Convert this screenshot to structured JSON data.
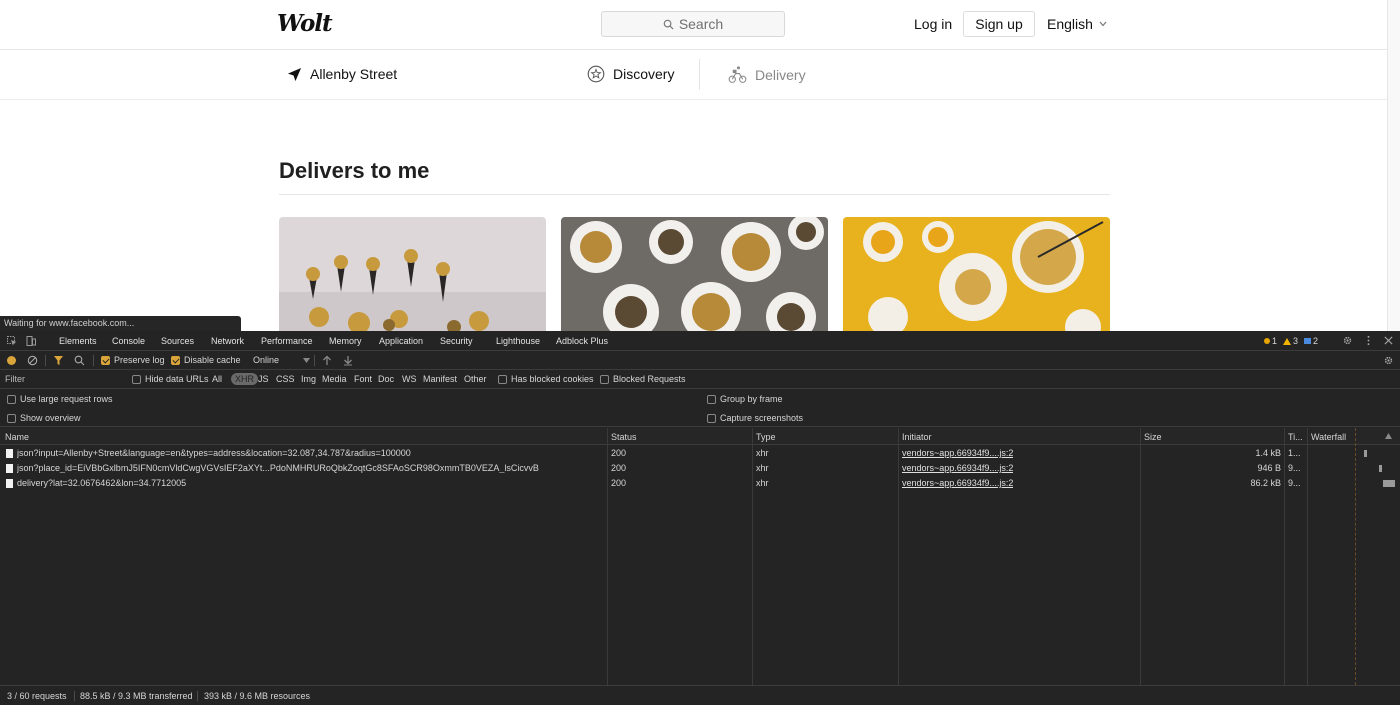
{
  "site": {
    "logo": "Wolt",
    "search_placeholder": "Search",
    "login": "Log in",
    "signup": "Sign up",
    "language": "English",
    "address": "Allenby Street",
    "discovery": "Discovery",
    "delivery": "Delivery",
    "section_title": "Delivers to me",
    "status_tip": "Waiting for www.facebook.com..."
  },
  "devtools": {
    "tabs": [
      "Elements",
      "Console",
      "Sources",
      "Network",
      "Performance",
      "Memory",
      "Application",
      "Security",
      "Lighthouse",
      "Adblock Plus"
    ],
    "counters": {
      "errors": "1",
      "warnings": "3",
      "info": "2"
    },
    "toolbar": {
      "preserve_log": "Preserve log",
      "disable_cache": "Disable cache",
      "throttle": "Online"
    },
    "filter": {
      "label": "Filter",
      "hide_data_urls": "Hide data URLs",
      "types": [
        "All",
        "XHR",
        "JS",
        "CSS",
        "Img",
        "Media",
        "Font",
        "Doc",
        "WS",
        "Manifest",
        "Other"
      ],
      "has_blocked_cookies": "Has blocked cookies",
      "blocked_requests": "Blocked Requests"
    },
    "options": {
      "large_rows": "Use large request rows",
      "show_overview": "Show overview",
      "group_by_frame": "Group by frame",
      "capture_screenshots": "Capture screenshots"
    },
    "columns": {
      "name": "Name",
      "status": "Status",
      "type": "Type",
      "initiator": "Initiator",
      "size": "Size",
      "time": "Ti...",
      "waterfall": "Waterfall"
    },
    "requests": [
      {
        "name": "json?input=Allenby+Street&language=en&types=address&location=32.087,34.787&radius=100000",
        "status": "200",
        "type": "xhr",
        "initiator": "vendors~app.66934f9....js:2",
        "size": "1.4 kB",
        "time": "1...",
        "waterfall_start": 0.62,
        "waterfall_width": 0.03
      },
      {
        "name": "json?place_id=EiVBbGxlbmJ5IFN0cmVldCwgVGVsIEF2aXYt...PdoNMHRURoQbkZoqtGc8SFAoSCR98OxmmTB0VEZA_lsCicvvB",
        "status": "200",
        "type": "xhr",
        "initiator": "vendors~app.66934f9....js:2",
        "size": "946 B",
        "time": "9...",
        "waterfall_start": 0.8,
        "waterfall_width": 0.03
      },
      {
        "name": "delivery?lat=32.0676462&lon=34.7712005",
        "status": "200",
        "type": "xhr",
        "initiator": "vendors~app.66934f9....js:2",
        "size": "86.2 kB",
        "time": "9...",
        "waterfall_start": 0.84,
        "waterfall_width": 0.14
      }
    ],
    "status_bar": {
      "requests": "3 / 60 requests",
      "transferred": "88.5 kB / 9.3 MB transferred",
      "resources": "393 kB / 9.6 MB resources"
    }
  }
}
